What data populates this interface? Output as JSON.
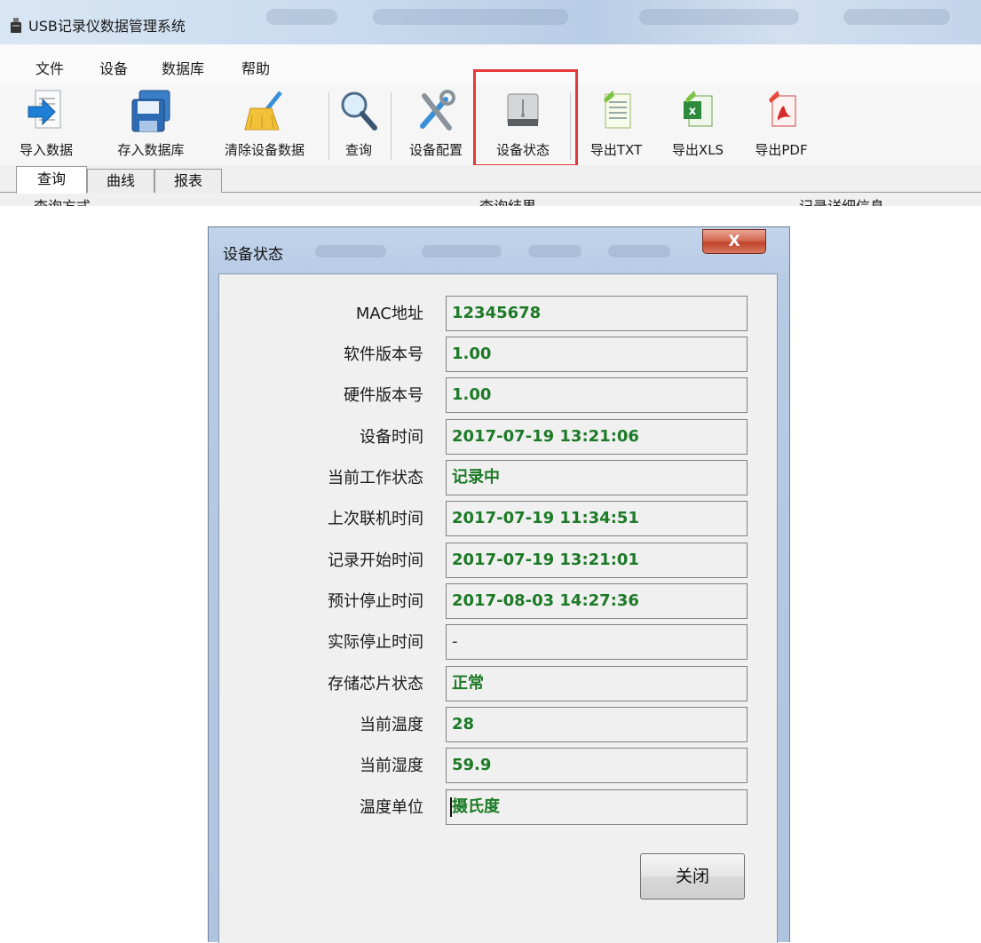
{
  "app": {
    "title": "USB记录仪数据管理系统",
    "menu": [
      "文件",
      "设备",
      "数据库",
      "帮助"
    ],
    "toolbar": [
      {
        "label": "导入数据",
        "icon": "import-data-icon"
      },
      {
        "label": "存入数据库",
        "icon": "save-database-icon"
      },
      {
        "label": "清除设备数据",
        "icon": "clear-broom-icon"
      },
      {
        "label": "查询",
        "icon": "magnifier-icon"
      },
      {
        "label": "设备配置",
        "icon": "tools-icon"
      },
      {
        "label": "设备状态",
        "icon": "usb-drive-icon"
      },
      {
        "label": "导出TXT",
        "icon": "txt-file-icon"
      },
      {
        "label": "导出XLS",
        "icon": "excel-file-icon"
      },
      {
        "label": "导出PDF",
        "icon": "pdf-file-icon"
      }
    ],
    "tabs": [
      "查询",
      "曲线",
      "报表"
    ],
    "section_headers": [
      "查询方式",
      "查询结果",
      "记录详细信息"
    ]
  },
  "dialog": {
    "title": "设备状态",
    "close_glyph": "X",
    "fields": [
      {
        "label": "MAC地址",
        "value": "12345678"
      },
      {
        "label": "软件版本号",
        "value": "1.00"
      },
      {
        "label": "硬件版本号",
        "value": "1.00"
      },
      {
        "label": "设备时间",
        "value": "2017-07-19 13:21:06"
      },
      {
        "label": "当前工作状态",
        "value": "记录中"
      },
      {
        "label": "上次联机时间",
        "value": "2017-07-19 11:34:51"
      },
      {
        "label": "记录开始时间",
        "value": "2017-07-19 13:21:01"
      },
      {
        "label": "预计停止时间",
        "value": "2017-08-03 14:27:36"
      },
      {
        "label": "实际停止时间",
        "value": "-"
      },
      {
        "label": "存储芯片状态",
        "value": "正常"
      },
      {
        "label": "当前温度",
        "value": "28"
      },
      {
        "label": "当前湿度",
        "value": "59.9"
      },
      {
        "label": "温度单位",
        "value": "摄氏度"
      }
    ],
    "close_button": "关闭"
  },
  "colors": {
    "value_text": "#1c7a26",
    "highlight_border": "#e53a3a",
    "dialog_frame": "#b7cbe5"
  }
}
